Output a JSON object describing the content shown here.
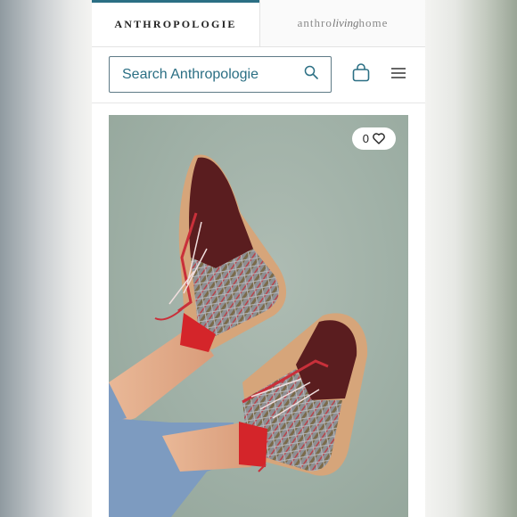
{
  "tabs": [
    {
      "label": "ANTHROPOLOGIE"
    },
    {
      "prefix": "anthro",
      "script": "living",
      "suffix": "home"
    }
  ],
  "search": {
    "placeholder": "Search Anthropologie",
    "value": ""
  },
  "header": {
    "bag_icon": "shopping-bag-icon",
    "menu_icon": "hamburger-menu-icon",
    "search_icon": "magnifier-icon"
  },
  "product": {
    "like_count": "0",
    "like_icon": "heart-outline-icon"
  },
  "colors": {
    "accent": "#2b6f84",
    "tab_indicator": "#2b6f84",
    "photo_background": "#9fb0a6"
  }
}
